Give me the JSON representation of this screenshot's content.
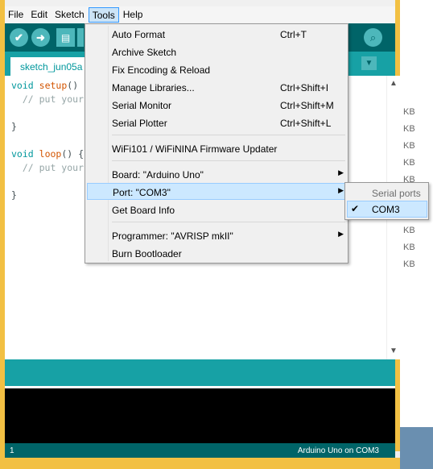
{
  "menubar": {
    "items": [
      "File",
      "Edit",
      "Sketch",
      "Tools",
      "Help"
    ]
  },
  "toolbar": {
    "verify_icon": "✔",
    "upload_icon": "➜",
    "new_icon": "▤",
    "serial_icon": "⌕"
  },
  "tab": {
    "label": "sketch_jun05a",
    "dropdown_icon": "▼"
  },
  "editor": {
    "lines": [
      [
        "void",
        " ",
        "setup",
        "() {"
      ],
      [
        "  // put your"
      ],
      [
        ""
      ],
      [
        "}"
      ],
      [
        ""
      ],
      [
        "void",
        " ",
        "loop",
        "() {"
      ],
      [
        "  // put your"
      ],
      [
        ""
      ],
      [
        "}"
      ]
    ]
  },
  "tools_menu": {
    "items": [
      {
        "label": "Auto Format",
        "shortcut": "Ctrl+T"
      },
      {
        "label": "Archive Sketch",
        "shortcut": ""
      },
      {
        "label": "Fix Encoding & Reload",
        "shortcut": ""
      },
      {
        "label": "Manage Libraries...",
        "shortcut": "Ctrl+Shift+I"
      },
      {
        "label": "Serial Monitor",
        "shortcut": "Ctrl+Shift+M"
      },
      {
        "label": "Serial Plotter",
        "shortcut": "Ctrl+Shift+L"
      },
      {
        "label": "WiFi101 / WiFiNINA Firmware Updater",
        "shortcut": ""
      },
      {
        "label": "Board: \"Arduino Uno\"",
        "shortcut": ""
      },
      {
        "label": "Port: \"COM3\"",
        "shortcut": ""
      },
      {
        "label": "Get Board Info",
        "shortcut": ""
      },
      {
        "label": "Programmer: \"AVRISP mkII\"",
        "shortcut": ""
      },
      {
        "label": "Burn Bootloader",
        "shortcut": ""
      }
    ],
    "submenu_arrow": "▶"
  },
  "port_submenu": {
    "header": "Serial ports",
    "item": "COM3",
    "check": "✔"
  },
  "status": {
    "line_number": "1",
    "board": "Arduino Uno on COM3"
  },
  "background_window": {
    "size_labels": [
      "KB",
      "KB",
      "KB",
      "KB",
      "KB",
      "KB",
      "KB",
      "KB",
      "KB"
    ]
  }
}
